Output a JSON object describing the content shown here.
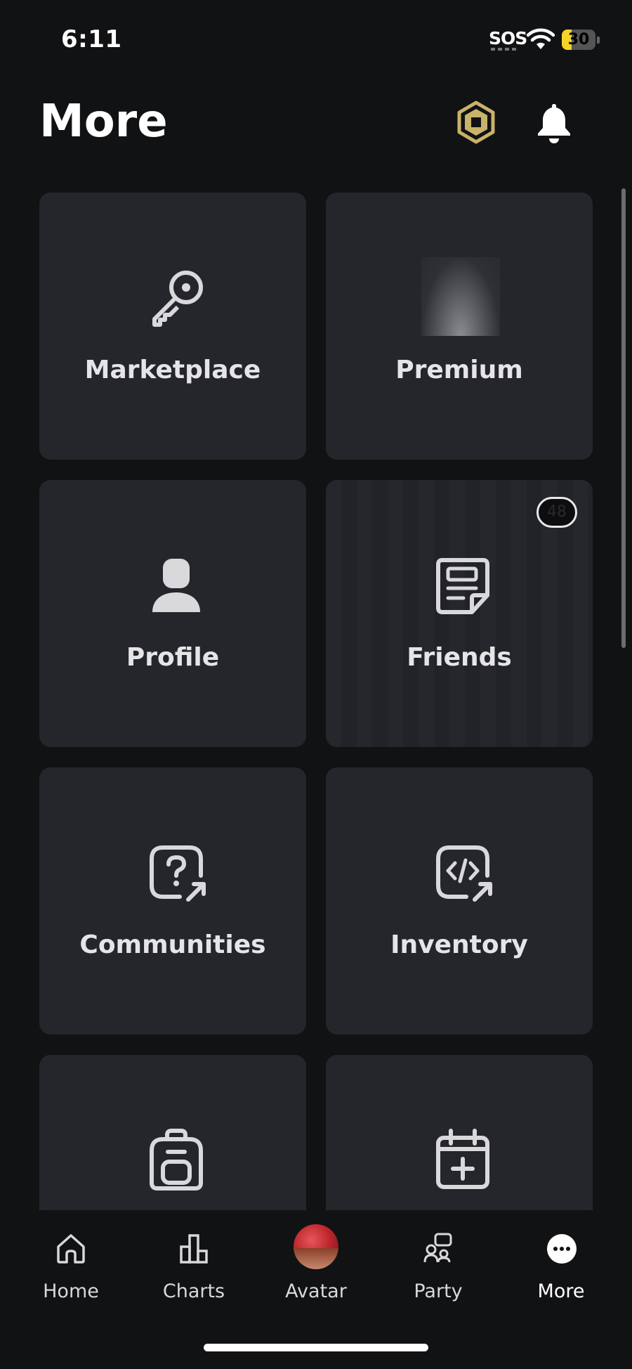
{
  "status_bar": {
    "time": "6:11",
    "sos": "SOS",
    "battery": "30",
    "battery_level": 0.3
  },
  "header": {
    "title": "More"
  },
  "tiles": [
    {
      "label": "Marketplace",
      "icon": "key-icon"
    },
    {
      "label": "Premium",
      "icon": "premium-image"
    },
    {
      "label": "Profile",
      "icon": "person-icon"
    },
    {
      "label": "Friends",
      "icon": "note-icon",
      "badge": "48"
    },
    {
      "label": "Communities",
      "icon": "help-external-icon"
    },
    {
      "label": "Inventory",
      "icon": "code-external-icon"
    },
    {
      "label": "",
      "icon": "backpack-icon"
    },
    {
      "label": "",
      "icon": "calendar-plus-icon"
    }
  ],
  "bottom_nav": [
    {
      "label": "Home",
      "icon": "home-icon"
    },
    {
      "label": "Charts",
      "icon": "charts-icon"
    },
    {
      "label": "Avatar",
      "icon": "avatar-image"
    },
    {
      "label": "Party",
      "icon": "party-icon"
    },
    {
      "label": "More",
      "icon": "more-icon"
    }
  ],
  "colors": {
    "background": "#111214",
    "tile": "#25262b",
    "text": "#e5e5e7",
    "robux": "#c9b26a"
  }
}
